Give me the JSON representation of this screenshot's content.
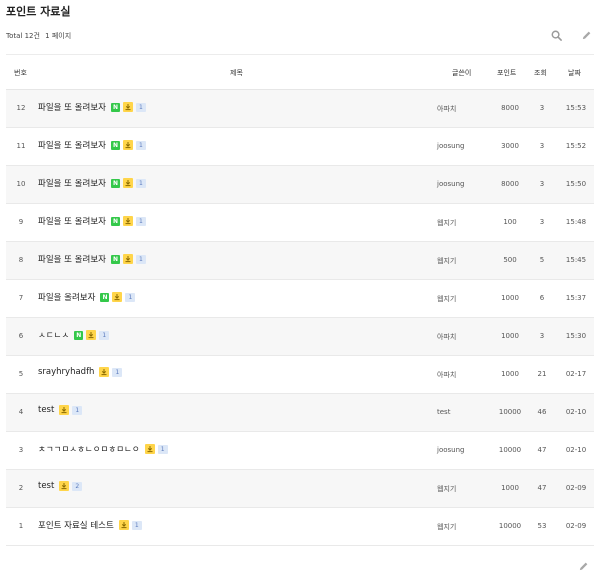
{
  "board": {
    "title": "포인트 자료실",
    "count_label": "Total 12건",
    "page_label": "1 페이지"
  },
  "icons": {
    "search": "search-icon",
    "write": "pencil-icon",
    "file": "download-icon"
  },
  "colors": {
    "new_badge": "#34c84a",
    "file_badge": "#ffd54a",
    "comment_badge_bg": "#dce7f7",
    "row_shade": "#f7f7f7"
  },
  "table": {
    "headers": {
      "num": "번호",
      "title": "제목",
      "author": "글쓴이",
      "point": "포인트",
      "views": "조회",
      "date": "날짜"
    },
    "new_label": "N",
    "rows": [
      {
        "num": "12",
        "title": "파일을 또 올려보자",
        "new": true,
        "comments": "1",
        "author": "아파치",
        "point": "8000",
        "views": "3",
        "date": "15:53"
      },
      {
        "num": "11",
        "title": "파일을 또 올려보자",
        "new": true,
        "comments": "1",
        "author": "joosung",
        "point": "3000",
        "views": "3",
        "date": "15:52"
      },
      {
        "num": "10",
        "title": "파일을 또 올려보자",
        "new": true,
        "comments": "1",
        "author": "joosung",
        "point": "8000",
        "views": "3",
        "date": "15:50"
      },
      {
        "num": "9",
        "title": "파일을 또 올려보자",
        "new": true,
        "comments": "1",
        "author": "웹지기",
        "point": "100",
        "views": "3",
        "date": "15:48"
      },
      {
        "num": "8",
        "title": "파일을 또 올려보자",
        "new": true,
        "comments": "1",
        "author": "웹지기",
        "point": "500",
        "views": "5",
        "date": "15:45"
      },
      {
        "num": "7",
        "title": "파일을 올려보자",
        "new": true,
        "comments": "1",
        "author": "웹지기",
        "point": "1000",
        "views": "6",
        "date": "15:37"
      },
      {
        "num": "6",
        "title": "ㅅㄷㄴㅅ",
        "new": true,
        "comments": "1",
        "author": "아파치",
        "point": "1000",
        "views": "3",
        "date": "15:30"
      },
      {
        "num": "5",
        "title": "srayhryhadfh",
        "new": false,
        "comments": "1",
        "author": "아파치",
        "point": "1000",
        "views": "21",
        "date": "02-17"
      },
      {
        "num": "4",
        "title": "test",
        "new": false,
        "comments": "1",
        "author": "test",
        "point": "10000",
        "views": "46",
        "date": "02-10"
      },
      {
        "num": "3",
        "title": "ㅊㄱㄱㅁㅅㅎㄴㅇㅁㅎㅁㄴㅇ",
        "new": false,
        "comments": "1",
        "author": "joosung",
        "point": "10000",
        "views": "47",
        "date": "02-10"
      },
      {
        "num": "2",
        "title": "test",
        "new": false,
        "comments": "2",
        "author": "웹지기",
        "point": "1000",
        "views": "47",
        "date": "02-09"
      },
      {
        "num": "1",
        "title": "포인트 자료실 테스트",
        "new": false,
        "comments": "1",
        "author": "웹지기",
        "point": "10000",
        "views": "53",
        "date": "02-09"
      }
    ]
  }
}
